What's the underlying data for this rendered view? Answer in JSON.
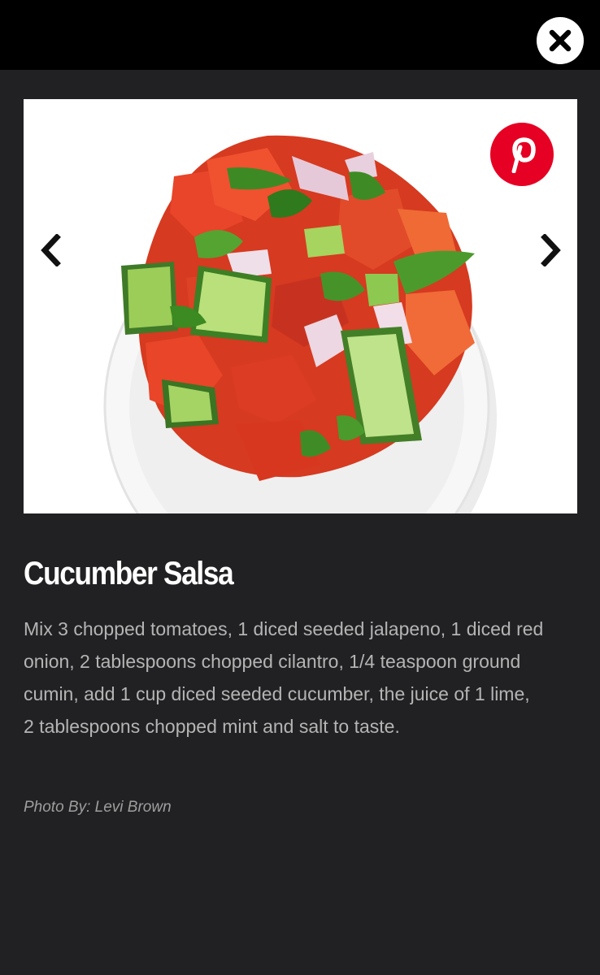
{
  "topbar": {
    "close_icon": "close-icon"
  },
  "slideshow": {
    "prev_icon": "chevron-left-icon",
    "next_icon": "chevron-right-icon",
    "share_icon": "pinterest-icon",
    "share_color": "#e60023"
  },
  "recipe": {
    "title": "Cucumber Salsa",
    "description": "Mix 3 chopped tomatoes, 1 diced seeded jalapeno, 1 diced red onion, 2 tablespoons chopped cilantro, 1/4 teaspoon ground cumin, add 1 cup diced seeded cucumber, the juice of 1 lime, 2 tablespoons chopped mint and salt to taste.",
    "credit": "Photo By: Levi Brown"
  },
  "colors": {
    "background": "#212123",
    "topbar": "#000000",
    "title": "#ffffff",
    "body_text": "#b4b4b4"
  }
}
